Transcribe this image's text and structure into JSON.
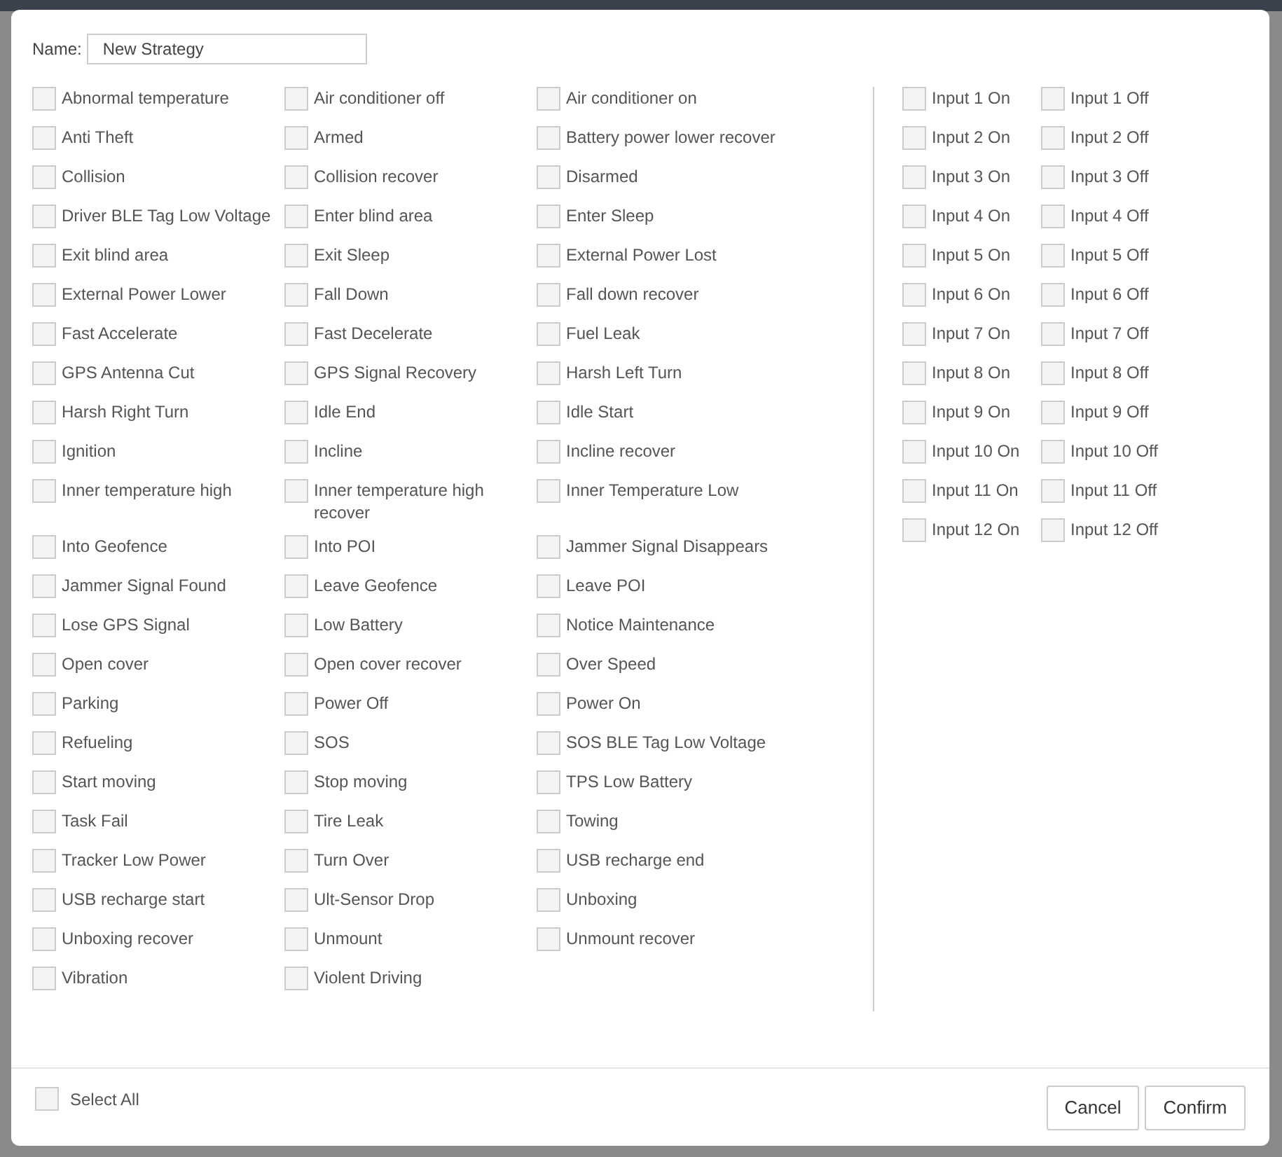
{
  "dialog": {
    "name_label": "Name:",
    "name_value": "New Strategy"
  },
  "events": [
    {
      "label": "Abnormal temperature",
      "checked": false
    },
    {
      "label": "Air conditioner off",
      "checked": false
    },
    {
      "label": "Air conditioner on",
      "checked": false
    },
    {
      "label": "Anti Theft",
      "checked": false
    },
    {
      "label": "Armed",
      "checked": false
    },
    {
      "label": "Battery power lower recover",
      "checked": false
    },
    {
      "label": "Collision",
      "checked": false
    },
    {
      "label": "Collision recover",
      "checked": false
    },
    {
      "label": "Disarmed",
      "checked": false
    },
    {
      "label": "Driver BLE Tag Low Voltage",
      "checked": false
    },
    {
      "label": "Enter blind area",
      "checked": false
    },
    {
      "label": "Enter Sleep",
      "checked": false
    },
    {
      "label": "Exit blind area",
      "checked": false
    },
    {
      "label": "Exit Sleep",
      "checked": false
    },
    {
      "label": "External Power Lost",
      "checked": false
    },
    {
      "label": "External Power Lower",
      "checked": false
    },
    {
      "label": "Fall Down",
      "checked": false
    },
    {
      "label": "Fall down recover",
      "checked": false
    },
    {
      "label": "Fast Accelerate",
      "checked": false
    },
    {
      "label": "Fast Decelerate",
      "checked": false
    },
    {
      "label": "Fuel Leak",
      "checked": false
    },
    {
      "label": "GPS Antenna Cut",
      "checked": false
    },
    {
      "label": "GPS Signal Recovery",
      "checked": false
    },
    {
      "label": "Harsh Left Turn",
      "checked": false
    },
    {
      "label": "Harsh Right Turn",
      "checked": false
    },
    {
      "label": "Idle End",
      "checked": false
    },
    {
      "label": "Idle Start",
      "checked": false
    },
    {
      "label": "Ignition",
      "checked": false
    },
    {
      "label": "Incline",
      "checked": false
    },
    {
      "label": "Incline recover",
      "checked": false
    },
    {
      "label": "Inner temperature high",
      "checked": false
    },
    {
      "label": "Inner temperature high recover",
      "checked": false
    },
    {
      "label": "Inner Temperature Low",
      "checked": false
    },
    {
      "label": "Into Geofence",
      "checked": false
    },
    {
      "label": "Into POI",
      "checked": false
    },
    {
      "label": "Jammer Signal Disappears",
      "checked": false
    },
    {
      "label": "Jammer Signal Found",
      "checked": false
    },
    {
      "label": "Leave Geofence",
      "checked": false
    },
    {
      "label": "Leave POI",
      "checked": false
    },
    {
      "label": "Lose GPS Signal",
      "checked": false
    },
    {
      "label": "Low Battery",
      "checked": false
    },
    {
      "label": "Notice Maintenance",
      "checked": false
    },
    {
      "label": "Open cover",
      "checked": false
    },
    {
      "label": "Open cover recover",
      "checked": false
    },
    {
      "label": "Over Speed",
      "checked": false
    },
    {
      "label": "Parking",
      "checked": false
    },
    {
      "label": "Power Off",
      "checked": false
    },
    {
      "label": "Power On",
      "checked": false
    },
    {
      "label": "Refueling",
      "checked": false
    },
    {
      "label": "SOS",
      "checked": false
    },
    {
      "label": "SOS BLE Tag Low Voltage",
      "checked": false
    },
    {
      "label": "Start moving",
      "checked": false
    },
    {
      "label": "Stop moving",
      "checked": false
    },
    {
      "label": "TPS Low Battery",
      "checked": false
    },
    {
      "label": "Task Fail",
      "checked": false
    },
    {
      "label": "Tire Leak",
      "checked": false
    },
    {
      "label": "Towing",
      "checked": false
    },
    {
      "label": "Tracker Low Power",
      "checked": false
    },
    {
      "label": "Turn Over",
      "checked": false
    },
    {
      "label": "USB recharge end",
      "checked": false
    },
    {
      "label": "USB recharge start",
      "checked": false
    },
    {
      "label": "Ult-Sensor Drop",
      "checked": false
    },
    {
      "label": "Unboxing",
      "checked": false
    },
    {
      "label": "Unboxing recover",
      "checked": false
    },
    {
      "label": "Unmount",
      "checked": false
    },
    {
      "label": "Unmount recover",
      "checked": false
    },
    {
      "label": "Vibration",
      "checked": false
    },
    {
      "label": "Violent Driving",
      "checked": false
    }
  ],
  "input_events": [
    {
      "label": "Input 1 On",
      "checked": false
    },
    {
      "label": "Input 1 Off",
      "checked": false
    },
    {
      "label": "Input 2 On",
      "checked": false
    },
    {
      "label": "Input 2 Off",
      "checked": false
    },
    {
      "label": "Input 3 On",
      "checked": false
    },
    {
      "label": "Input 3 Off",
      "checked": false
    },
    {
      "label": "Input 4 On",
      "checked": false
    },
    {
      "label": "Input 4 Off",
      "checked": false
    },
    {
      "label": "Input 5 On",
      "checked": false
    },
    {
      "label": "Input 5 Off",
      "checked": false
    },
    {
      "label": "Input 6 On",
      "checked": false
    },
    {
      "label": "Input 6 Off",
      "checked": false
    },
    {
      "label": "Input 7 On",
      "checked": false
    },
    {
      "label": "Input 7 Off",
      "checked": false
    },
    {
      "label": "Input 8 On",
      "checked": false
    },
    {
      "label": "Input 8 Off",
      "checked": false
    },
    {
      "label": "Input 9 On",
      "checked": false
    },
    {
      "label": "Input 9 Off",
      "checked": false
    },
    {
      "label": "Input 10 On",
      "checked": false
    },
    {
      "label": "Input 10 Off",
      "checked": false
    },
    {
      "label": "Input 11 On",
      "checked": false
    },
    {
      "label": "Input 11 Off",
      "checked": false
    },
    {
      "label": "Input 12 On",
      "checked": false
    },
    {
      "label": "Input 12 Off",
      "checked": false
    }
  ],
  "footer": {
    "select_all": {
      "label": "Select All",
      "checked": false
    },
    "buttons": [
      "Cancel",
      "Confirm"
    ]
  }
}
